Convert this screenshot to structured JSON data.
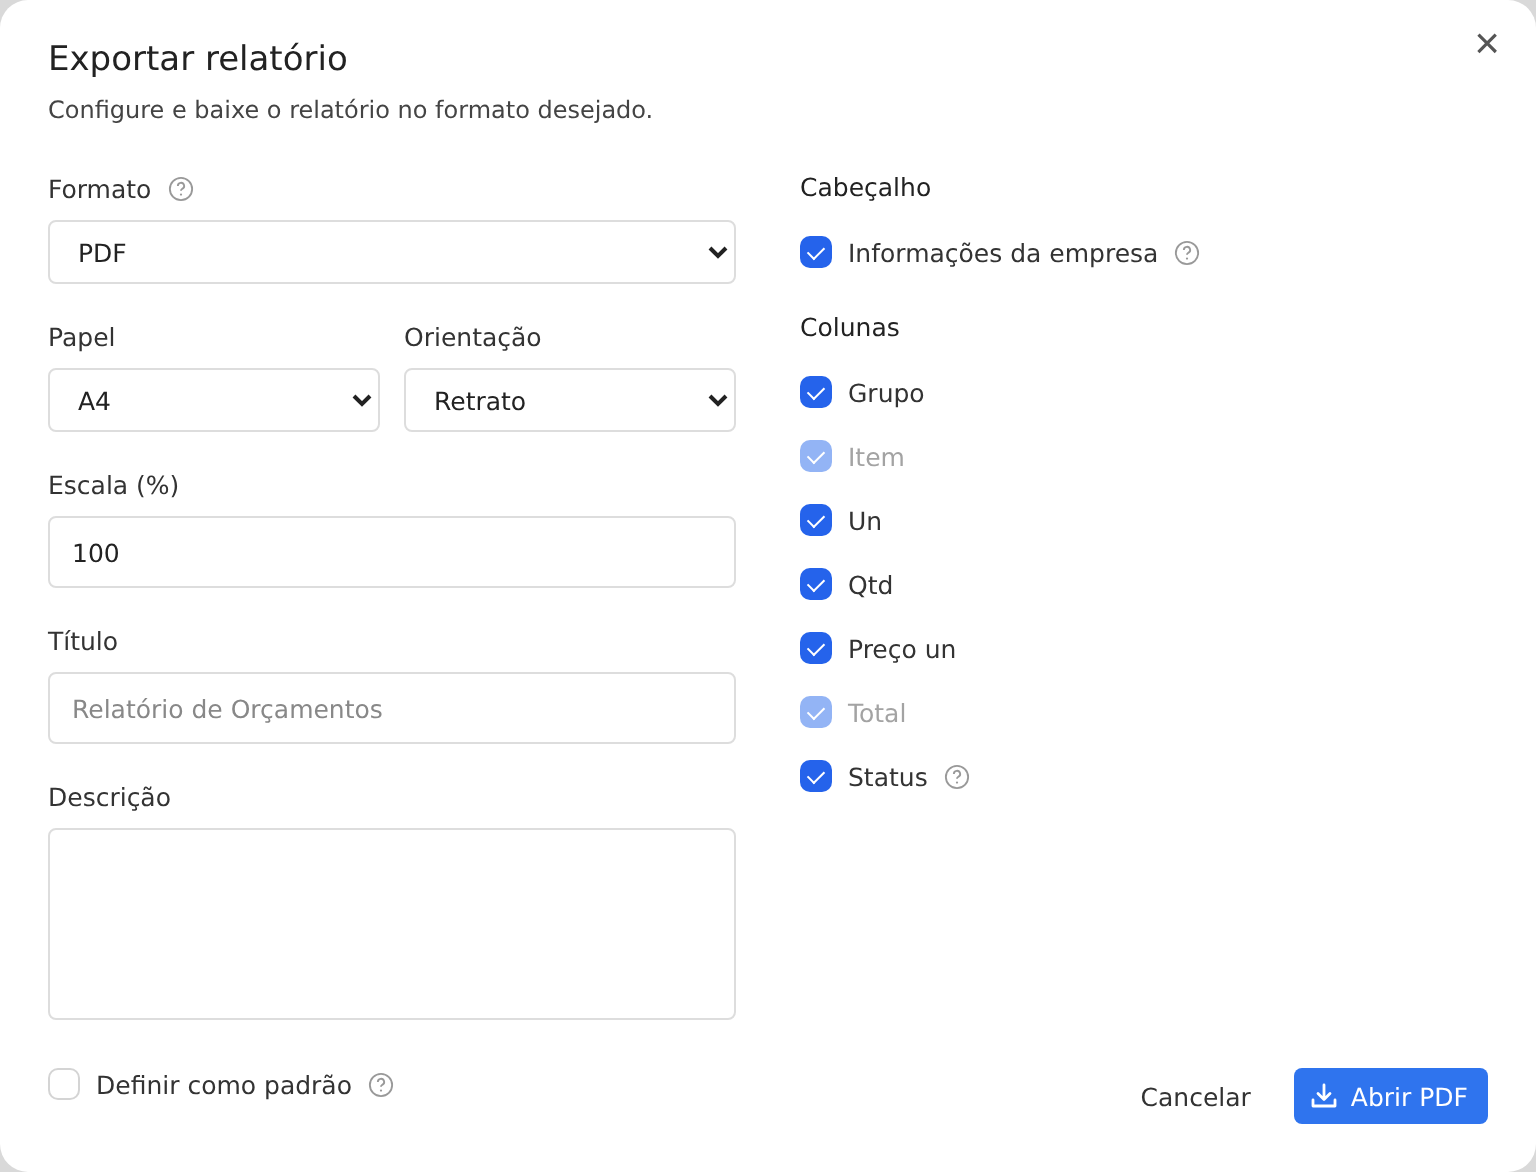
{
  "dialog": {
    "title": "Exportar relatório",
    "subtitle": "Configure e baixe o relatório no formato desejado.",
    "close": "×"
  },
  "left": {
    "format": {
      "label": "Formato",
      "help": true,
      "value": "PDF"
    },
    "paper": {
      "label": "Papel",
      "value": "A4"
    },
    "orientation": {
      "label": "Orientação",
      "value": "Retrato"
    },
    "scale": {
      "label": "Escala (%)",
      "value": "100"
    },
    "title": {
      "label": "Título",
      "placeholder": "Relatório de Orçamentos"
    },
    "description": {
      "label": "Descrição"
    }
  },
  "right": {
    "sections": [
      {
        "heading": "Cabeçalho",
        "items": [
          {
            "label": "Informações da empresa",
            "checked": true,
            "disabled": false,
            "help": true
          }
        ]
      },
      {
        "heading": "Colunas",
        "items": [
          {
            "label": "Grupo",
            "checked": true,
            "disabled": false,
            "help": false
          },
          {
            "label": "Item",
            "checked": true,
            "disabled": true,
            "help": false
          },
          {
            "label": "Un",
            "checked": true,
            "disabled": false,
            "help": false
          },
          {
            "label": "Qtd",
            "checked": true,
            "disabled": false,
            "help": false
          },
          {
            "label": "Preço un",
            "checked": true,
            "disabled": false,
            "help": false
          },
          {
            "label": "Total",
            "checked": true,
            "disabled": true,
            "help": false
          },
          {
            "label": "Status",
            "checked": true,
            "disabled": false,
            "help": true
          }
        ]
      }
    ]
  },
  "footer": {
    "default": {
      "label": "Definir como padrão",
      "checked": false,
      "help": true
    },
    "cancel": "Cancelar",
    "primary": "Abrir PDF"
  }
}
